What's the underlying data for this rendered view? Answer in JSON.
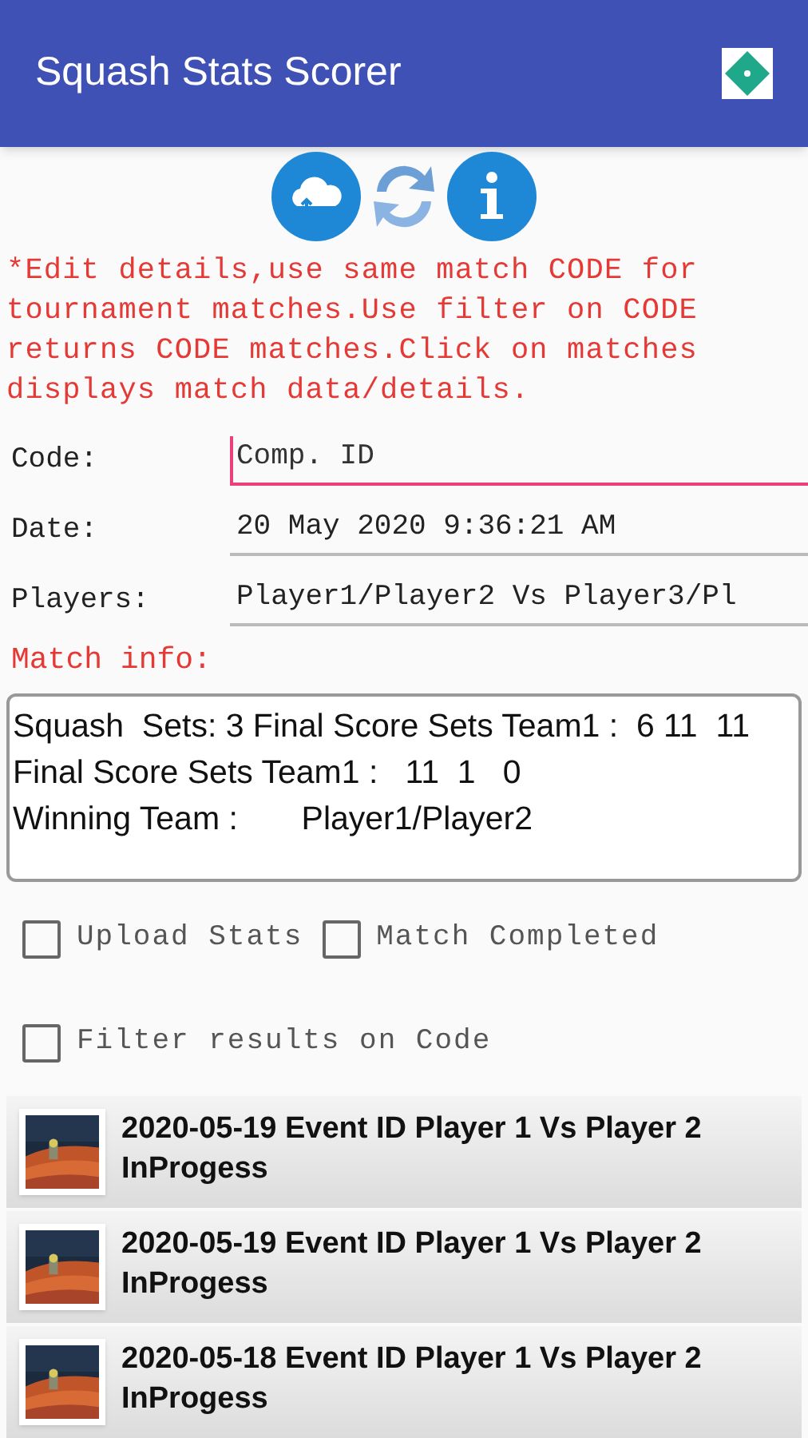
{
  "app_bar": {
    "title": "Squash Stats Scorer"
  },
  "notice": "*Edit details,use same match CODE for tournament matches.Use filter on CODE returns CODE matches.Click on matches displays match data/details.",
  "fields": [
    {
      "label": "Code:",
      "placeholder": "Comp. ID",
      "focused": true
    },
    {
      "label": "Date:",
      "value": "20 May 2020 9:36:21 AM",
      "focused": false
    },
    {
      "label": "Players:",
      "value": "Player1/Player2 Vs Player3/Pl",
      "focused": false
    }
  ],
  "match_info": {
    "label": "Match info:",
    "lines": [
      "Squash  Sets: 3 Final Score Sets Team1 :  6 11  11",
      "Final Score Sets Team1 :   11  1   0",
      "Winning Team :       Player1/Player2"
    ]
  },
  "checkboxes": [
    {
      "label": "Upload Stats",
      "checked": false
    },
    {
      "label": "Match Completed",
      "checked": false
    },
    {
      "label": "Filter results on Code",
      "checked": false
    }
  ],
  "matches": [
    {
      "title": "2020-05-19 Event ID Player 1 Vs Player 2",
      "status": "InProgess"
    },
    {
      "title": "2020-05-19 Event ID Player 1 Vs Player 2",
      "status": "InProgess"
    },
    {
      "title": "2020-05-18 Event ID Player 1 Vs Player 2",
      "status": "InProgess"
    }
  ]
}
